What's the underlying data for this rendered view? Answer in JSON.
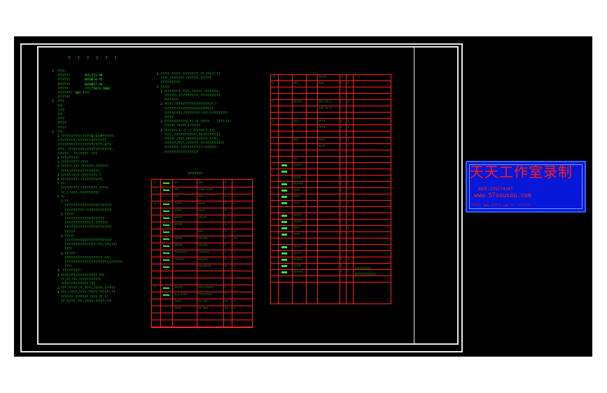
{
  "drawing": {
    "main_title": "? ? ? ? ? ?",
    "table_left_title": "???????",
    "notes_col1": [
      "1  ????:",
      "   ???????        API/IIS-98",
      "   ???????        GB50054-95",
      "   ???????        GB50057-94",
      "   ??????         ???/T50?4-2000",
      "   ????????  GBJ 5???",
      "   ???????",
      "",
      "2  ????",
      "   ???",
      "   ????",
      "   ???",
      "   ????",
      "   ?????",
      "   ?????",
      "",
      "3  ???",
      "   1.???????????,?????2-1?/P??????,",
      "   ???/??????,????????????????,",
      "   ????(???)???????????/????-3???",
      "   ????, ????/????/??????????????,",
      "   ??????:  ??/?????  ???",
      "",
      "   2.???(???)??",
      "   1,?????????? ????",
      "   2.??????:???-???????,???????",
      "     ????/???????/????????,",
      "   3.?????-??/?:?????????,?",
      "   4.?????????? ????????????.",
      "",
      "   ? ??:",
      "     ??????????,?????????,?????",
      "     ??,?,????,???????????.",
      "",
      "   ? ??",
      "     1,??",
      "       ??????????????????????????",
      "       ??????????? ??????????????",
      "",
      "     2.?????",
      "       ??????????????????????",
      "       ????????????????.???????",
      "       ??????????????????????????",
      "       ??????",
      "     3.?????",
      "       ??????????????????????????",
      "       ????????????????? ???,???(???",
      "       ????",
      "     4.??????",
      "       ????????????????????? ???,",
      "       ????????????????????????(??)????",
      "       ????",
      "",
      "   4  ??????????",
      "   1.????(???)??????????? ???",
      "     ??,??,???,????????????",
      "     ??????????????? ???",
      "   2.???:?????.??,????,?????,??????",
      "",
      "   3.???,?????,????,?????,???(??.??",
      "     ???????-??????? ???? ?? ??",
      "     ??.??/?? ???.?????.?????.???"
    ],
    "notes_col2": [
      "4 ????? ?????:?????????.??.???(?.??",
      "  ????,????????.???????.??????",
      "  ???????????",
      "5 ?????",
      "",
      "  1.?????????,????,??????.????????.",
      "    ???????.???????????.???????????.",
      "    ????????",
      "  2.?????:?????????????????????.?",
      "    ???????????????????????????",
      "    ?????(???),?????????.???,??????????",
      "    ?????",
      "  3.?????????????,??.??.?????.   ????.???",
      "    ?????? ????? ???????",
      "",
      "  4.???????-?--?'.?.??????.?.???.",
      "    ????,?????????????,????????????",
      "    ??????,????,????????????,????,",
      "    ???????????,??????? ?????????????",
      "    ????????.????????????.???????",
      "    ???????????????????"
    ],
    "left_table_rows": [
      [
        "?",
        "?",
        "??",
        "???",
        "?",
        "?"
      ],
      [
        "?",
        "?",
        "???",
        "???? ????",
        "?",
        "?"
      ],
      [
        "",
        "?",
        "??",
        "???",
        "?",
        "?"
      ],
      [
        "?",
        "?",
        "????",
        "??/?",
        "?",
        "?"
      ],
      [
        "",
        "?",
        "?????",
        "??/?",
        "?",
        "?"
      ],
      [
        "",
        "?",
        "?????",
        "???/?",
        "?",
        "?"
      ],
      [
        "",
        "?",
        "?????",
        "",
        "?",
        "?"
      ],
      [
        "",
        "?",
        "",
        "???",
        "?",
        "?"
      ],
      [
        "",
        "?",
        "?????",
        "??/???",
        "?",
        "??"
      ],
      [
        "",
        "?",
        "?????",
        "??/???",
        "?",
        "?"
      ],
      [
        "",
        "?",
        "????????",
        "???/???",
        "?",
        "?"
      ],
      [
        "",
        "?",
        "??????",
        "???/??",
        "?",
        "?"
      ],
      [
        "",
        "?",
        "",
        "??/?????",
        "?",
        "?"
      ],
      [
        "",
        "",
        "",
        "",
        "",
        ""
      ],
      [
        "",
        "",
        "",
        "",
        "",
        ""
      ],
      [
        "?",
        "?",
        "?????",
        "???(?????)",
        "?",
        "?"
      ],
      [
        "",
        "?",
        "?:?  ????",
        "???(????)",
        "?",
        "?"
      ],
      [
        "?",
        "",
        "????",
        "??-???",
        "??",
        "?"
      ],
      [
        "",
        "",
        "????",
        "??-???",
        "??",
        "?"
      ],
      [
        "",
        "",
        "",
        "",
        "",
        ""
      ],
      [
        "",
        "",
        "",
        "",
        "",
        ""
      ]
    ],
    "right_table_header": [
      "??",
      "?",
      "?",
      "?",
      "?????",
      "??",
      "?",
      "?"
    ],
    "right_table_rows": [
      [
        "?",
        "???",
        "???",
        "?",
        "?"
      ],
      [
        "",
        "",
        "",
        "",
        ""
      ],
      [
        "",
        "",
        "",
        "",
        ""
      ],
      [
        "?",
        "?????",
        "???-??-?",
        "?",
        "?"
      ],
      [
        "",
        "",
        "???-??-?",
        "?",
        "?"
      ],
      [
        "",
        "",
        "",
        "",
        ""
      ],
      [
        "?",
        "???",
        "????",
        "?",
        "?"
      ],
      [
        "",
        "",
        "????",
        "?",
        "?"
      ],
      [
        "",
        "",
        "",
        "",
        ""
      ],
      [
        "?",
        "???",
        "????",
        "?",
        "?"
      ],
      [
        "",
        "",
        "????",
        "?",
        "?"
      ],
      [
        "",
        "",
        "",
        "",
        ""
      ],
      [
        "?",
        "???",
        "",
        "?",
        "?"
      ],
      [
        "",
        "?????",
        "",
        "?",
        "?"
      ],
      [
        "",
        "",
        "",
        "",
        ""
      ],
      [
        "",
        "?????",
        "",
        "?",
        "?"
      ],
      [
        "",
        "??????",
        "",
        "?",
        "?"
      ],
      [
        "",
        "????",
        "",
        "?",
        "?"
      ],
      [
        "",
        "????",
        "",
        "?",
        "?"
      ],
      [
        "",
        "????",
        "",
        "?",
        "?"
      ],
      [
        "",
        "",
        "",
        "",
        ""
      ],
      [
        "",
        "?????",
        "",
        "?",
        "?"
      ],
      [
        "",
        "?????",
        "",
        "?",
        "?"
      ],
      [
        "",
        "????",
        "",
        "?",
        "?"
      ],
      [
        "",
        "????",
        "",
        "?",
        "?"
      ],
      [
        "",
        "",
        "",
        "",
        ""
      ],
      [
        "",
        "?????",
        "",
        "?",
        "?"
      ],
      [
        "",
        "?????",
        "",
        "?",
        "?"
      ],
      [
        "",
        "??????",
        "",
        "?",
        "?"
      ],
      [
        "",
        "?????",
        "",
        "?",
        "?"
      ],
      [
        "",
        "??????",
        "",
        "?",
        "?"
      ],
      [
        "",
        "",
        "",
        "",
        ""
      ]
    ],
    "right_table_footnote_1": "??????????.",
    "right_table_footnote_2": "?????????????"
  },
  "watermark": {
    "title": "天天工作室录制",
    "qq": "QQ号:2352?4347",
    "site": "www.57sousou.com",
    "footer": "?????: www.??????.com  ??: ????????"
  },
  "colors": {
    "background": "#000000",
    "frame": "#e8e8e8",
    "text_green": "#2ee82e",
    "table_red": "#ff2020",
    "watermark_blue": "#0718d8",
    "watermark_red": "#ff1a1a"
  }
}
